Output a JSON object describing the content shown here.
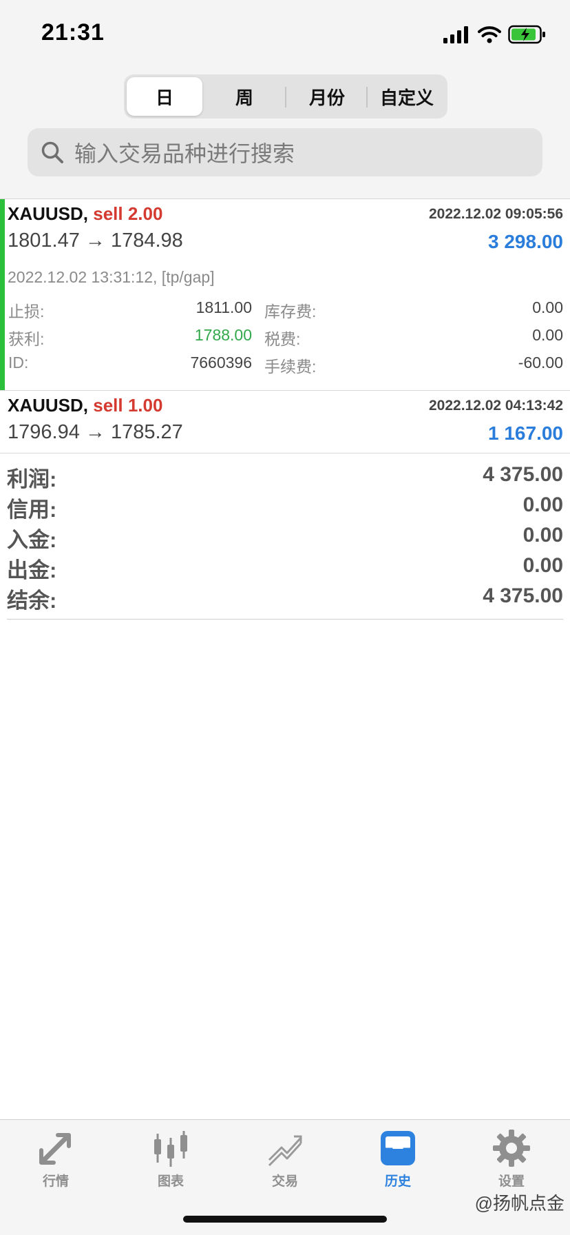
{
  "status_bar": {
    "time": "21:31"
  },
  "segments": {
    "day": "日",
    "week": "周",
    "month": "月份",
    "custom": "自定义",
    "active": "day"
  },
  "search": {
    "placeholder": "输入交易品种进行搜索"
  },
  "deals": [
    {
      "symbol": "XAUUSD,",
      "side": "sell 2.00",
      "open_time": "2022.12.02 09:05:56",
      "prices": "1801.47 → 1784.98",
      "profit": "3 298.00",
      "close_info": "2022.12.02 13:31:12, [tp/gap]",
      "details": {
        "sl_label": "止损:",
        "sl_value": "1811.00",
        "swap_label": "库存费:",
        "swap_value": "0.00",
        "tp_label": "获利:",
        "tp_value": "1788.00",
        "tax_label": "税费:",
        "tax_value": "0.00",
        "id_label": "ID:",
        "id_value": "7660396",
        "commission_label": "手续费:",
        "commission_value": "-60.00"
      }
    },
    {
      "symbol": "XAUUSD,",
      "side": "sell 1.00",
      "open_time": "2022.12.02 04:13:42",
      "prices": "1796.94 → 1785.27",
      "profit": "1 167.00"
    }
  ],
  "summary": [
    {
      "label": "利润:",
      "value": "4 375.00"
    },
    {
      "label": "信用:",
      "value": "0.00"
    },
    {
      "label": "入金:",
      "value": "0.00"
    },
    {
      "label": "出金:",
      "value": "0.00"
    },
    {
      "label": "结余:",
      "value": "4 375.00"
    }
  ],
  "tabbar": {
    "quotes": "行情",
    "charts": "图表",
    "trade": "交易",
    "history": "历史",
    "settings": "设置",
    "active": "history"
  },
  "watermark": "@扬帆点金",
  "colors": {
    "accent_blue": "#2a7ddb",
    "sell_red": "#d43a2f",
    "tp_green": "#32a84a",
    "row_indicator_green": "#2cbf3c"
  }
}
